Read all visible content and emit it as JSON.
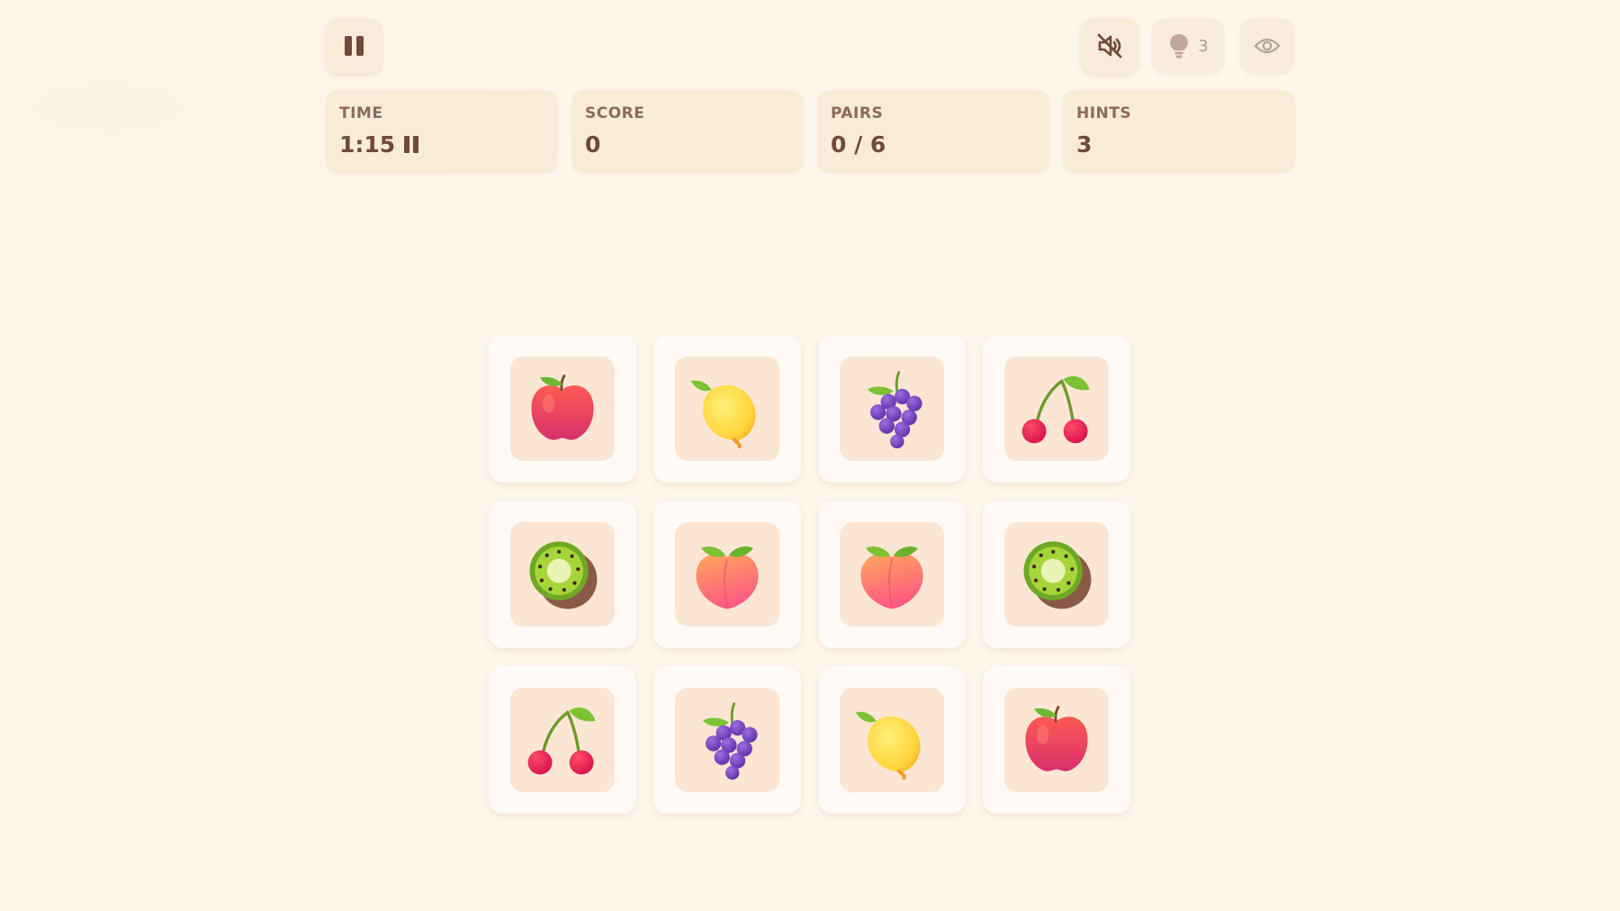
{
  "controls": {
    "pause_icon": "pause-icon",
    "mute_icon": "speaker-muted-icon",
    "hint_icon": "lightbulb-icon",
    "hint_count": "3",
    "reveal_icon": "eye-icon"
  },
  "stats": {
    "time": {
      "label": "TIME",
      "value": "1:15"
    },
    "score": {
      "label": "SCORE",
      "value": "0"
    },
    "pairs": {
      "label": "PAIRS",
      "value": "0 / 6"
    },
    "hints": {
      "label": "HINTS",
      "value": "3"
    }
  },
  "board": {
    "rows": 3,
    "cols": 4,
    "cards": [
      "apple",
      "lemon",
      "grapes",
      "cherries",
      "kiwi",
      "peach",
      "peach",
      "kiwi",
      "cherries",
      "grapes",
      "lemon",
      "apple"
    ]
  },
  "colors": {
    "background": "#fff6ec",
    "panel": "#f8ebd8",
    "card": "#fffaf5",
    "card_face": "#fbe6d4",
    "text": "#6e4a3c"
  }
}
